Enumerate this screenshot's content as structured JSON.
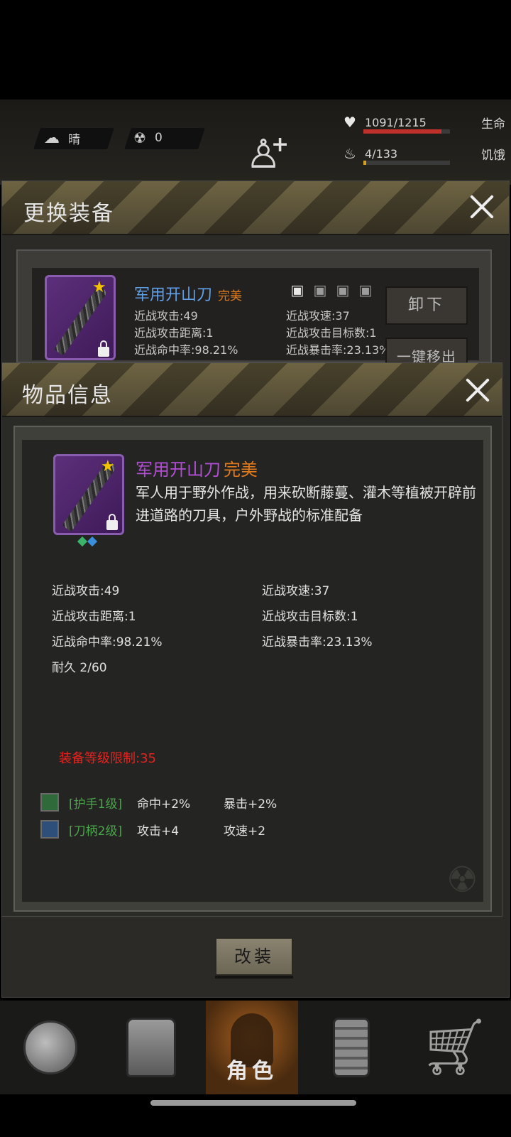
{
  "status": {
    "weather": "晴",
    "radiation": "0",
    "health": {
      "value": "1091/1215",
      "label": "生命",
      "fraction": 0.898
    },
    "hunger": {
      "value": "4/133",
      "label": "饥饿",
      "fraction": 0.03
    }
  },
  "equip_dialog": {
    "title": "更换装备",
    "item": {
      "name": "军用开山刀",
      "quality": "完美",
      "stats_left": [
        "近战攻击:49",
        "近战攻击距离:1",
        "近战命中率:98.21%"
      ],
      "stats_right": [
        "近战攻速:37",
        "近战攻击目标数:1",
        "近战暴击率:23.13%"
      ]
    },
    "unequip_label": "卸下",
    "remove_all_label": "一键移出",
    "modify_label": "改装"
  },
  "item_dialog": {
    "title": "物品信息",
    "name": "军用开山刀",
    "quality": "完美",
    "description": "军人用于野外作战，用来砍断藤蔓、灌木等植被开辟前进道路的刀具，户外野战的标准配备",
    "attrs_left": [
      "近战攻击:49",
      "近战攻击距离:1",
      "近战命中率:98.21%",
      "耐久 2/60"
    ],
    "attrs_right": [
      "近战攻速:37",
      "近战攻击目标数:1",
      "近战暴击率:23.13%"
    ],
    "level_limit": "装备等级限制:35",
    "mods": [
      {
        "name": "[护手1级]",
        "a": "命中+2%",
        "b": "暴击+2%",
        "icon": "handguard-icon",
        "color": "#2e6a3a"
      },
      {
        "name": "[刀柄2级]",
        "a": "攻击+4",
        "b": "攻速+2",
        "icon": "handle-icon",
        "color": "#2e4f7a"
      }
    ]
  },
  "nav": {
    "items": [
      "world-icon",
      "backpack-icon",
      "character-icon",
      "radio-icon",
      "shop-icon"
    ],
    "active_label": "角色"
  },
  "colors": {
    "accent_purple": "#b14ed4",
    "quality_orange": "#e07a1c",
    "limit_red": "#e8221e",
    "mod_green": "#4aa64a",
    "health_red": "#c0302a"
  }
}
